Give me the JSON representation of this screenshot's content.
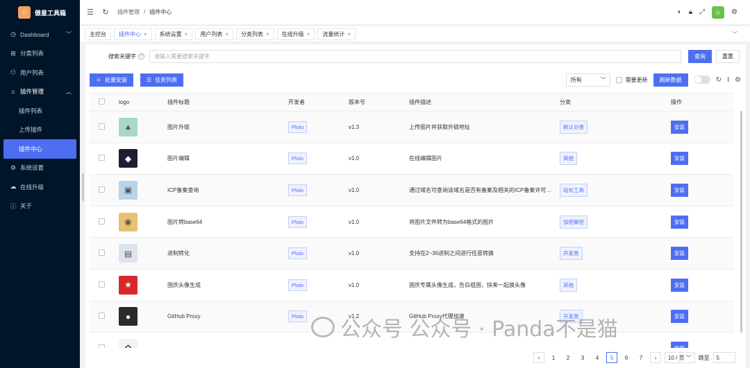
{
  "app": {
    "title": "傲星工具箱"
  },
  "sidebar": {
    "items": [
      {
        "label": "Dashboard",
        "icon": "dashboard-icon",
        "has_arrow": true
      },
      {
        "label": "分类列表",
        "icon": "gift-icon"
      },
      {
        "label": "用户列表",
        "icon": "users-icon"
      },
      {
        "label": "插件管理",
        "icon": "puzzle-icon",
        "open": true
      },
      {
        "label": "插件列表",
        "sub": true
      },
      {
        "label": "上传插件",
        "sub": true
      },
      {
        "label": "插件中心",
        "sub": true,
        "active": true
      },
      {
        "label": "系统设置",
        "icon": "gear-icon"
      },
      {
        "label": "在线升级",
        "icon": "cloud-icon"
      },
      {
        "label": "关于",
        "icon": "info-icon"
      }
    ]
  },
  "header": {
    "breadcrumb": [
      "插件管理",
      "插件中心"
    ]
  },
  "tabs": [
    {
      "label": "主控台",
      "closable": false
    },
    {
      "label": "插件中心",
      "closable": true,
      "active": true
    },
    {
      "label": "系统设置",
      "closable": true
    },
    {
      "label": "用户列表",
      "closable": true
    },
    {
      "label": "分类列表",
      "closable": true
    },
    {
      "label": "在线升级",
      "closable": true
    },
    {
      "label": "流量统计",
      "closable": true
    }
  ],
  "search": {
    "label": "搜索关键字",
    "placeholder": "请输入需要搜索关键字",
    "query_label": "查询",
    "reset_label": "重置"
  },
  "toolbar": {
    "batch_install": "批量安装",
    "task_list": "任务列表",
    "filter_value": "所有",
    "need_update": "需要更新",
    "refresh": "刷新数据"
  },
  "table": {
    "headers": [
      "logo",
      "插件标题",
      "开发者",
      "版本号",
      "插件描述",
      "分类",
      "操作"
    ],
    "rows": [
      {
        "title": "图片外链",
        "dev": "Pluto",
        "version": "v1.3",
        "desc": "上传图片并获取外链地址",
        "category": "默认分类",
        "action": "安装",
        "logo_color": "#a8d8c8",
        "logo_glyph": "▲"
      },
      {
        "title": "图片编辑",
        "dev": "Pluto",
        "version": "v1.0",
        "desc": "在线编辑图片",
        "category": "其他",
        "action": "安装",
        "logo_color": "#1f1f33",
        "logo_glyph": "◆"
      },
      {
        "title": "ICP备案查询",
        "dev": "Pluto",
        "version": "v1.0",
        "desc": "通过域名可查询该域名是否有备案及相关的ICP备案许可信息",
        "category": "站长工具",
        "action": "安装",
        "logo_color": "#b8d4e8",
        "logo_glyph": "▣"
      },
      {
        "title": "图片转base64",
        "dev": "Pluto",
        "version": "v1.0",
        "desc": "将图片文件转为base64格式的图片",
        "category": "加密解密",
        "action": "安装",
        "logo_color": "#e8c070",
        "logo_glyph": "◉"
      },
      {
        "title": "进制转化",
        "dev": "Pluto",
        "version": "v1.0",
        "desc": "支持在2~36进制之间进行任意转换",
        "category": "开发类",
        "action": "安装",
        "logo_color": "#dde4ee",
        "logo_glyph": "▤"
      },
      {
        "title": "国庆头像生成",
        "dev": "Pluto",
        "version": "v1.0",
        "desc": "国庆专属头像生成，告白祖国，快来一起换头像",
        "category": "其他",
        "action": "安装",
        "logo_color": "#d8282a",
        "logo_glyph": "★"
      },
      {
        "title": "GitHub Proxy",
        "dev": "Pluto",
        "version": "v1.2",
        "desc": "GitHub Proxy代理加速",
        "category": "开发类",
        "action": "安装",
        "logo_color": "#2b2b2b",
        "logo_glyph": "●"
      },
      {
        "title": "",
        "dev": "",
        "version": "",
        "desc": "",
        "category": "",
        "action": "安装",
        "logo_color": "#f3f3f3",
        "logo_glyph": "✿"
      }
    ]
  },
  "pagination": {
    "pages": [
      "1",
      "2",
      "3",
      "4",
      "5",
      "6",
      "7"
    ],
    "current": "5",
    "page_size": "10 / 页",
    "jump_label": "跳至",
    "jump_value": "5"
  },
  "watermark": {
    "text": "公众号 公众号 · Panda不是猫"
  }
}
